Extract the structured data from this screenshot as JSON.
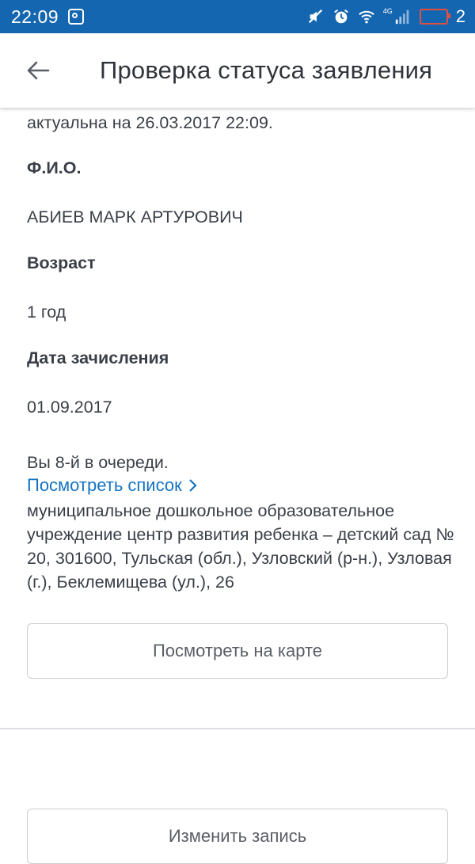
{
  "status_bar": {
    "time": "22:09",
    "network": "4G",
    "battery_level": "2"
  },
  "app_bar": {
    "title": "Проверка статуса заявления"
  },
  "content": {
    "notice_partial": "актуальна на 26.03.2017 22:09.",
    "fio_label": "Ф.И.О.",
    "fio_value": "АБИЕВ МАРК АРТУРОВИЧ",
    "age_label": "Возраст",
    "age_value": "1 год",
    "enroll_date_label": "Дата зачисления",
    "enroll_date_value": "01.09.2017",
    "queue_text": "Вы 8-й в очереди.",
    "view_list_link": "Посмотреть список",
    "institution_address": "муниципальное дошкольное образовательное учреждение центр развития ребенка – детский сад № 20, 301600, Тульская (обл.), Узловский (р-н.), Узловая (г.), Беклемищева (ул.), 26",
    "view_on_map_button": "Посмотреть на карте",
    "edit_record_button": "Изменить запись"
  },
  "colors": {
    "status_bar_bg": "#1566b0",
    "link": "#1574c2",
    "battery_low": "#e05040"
  }
}
